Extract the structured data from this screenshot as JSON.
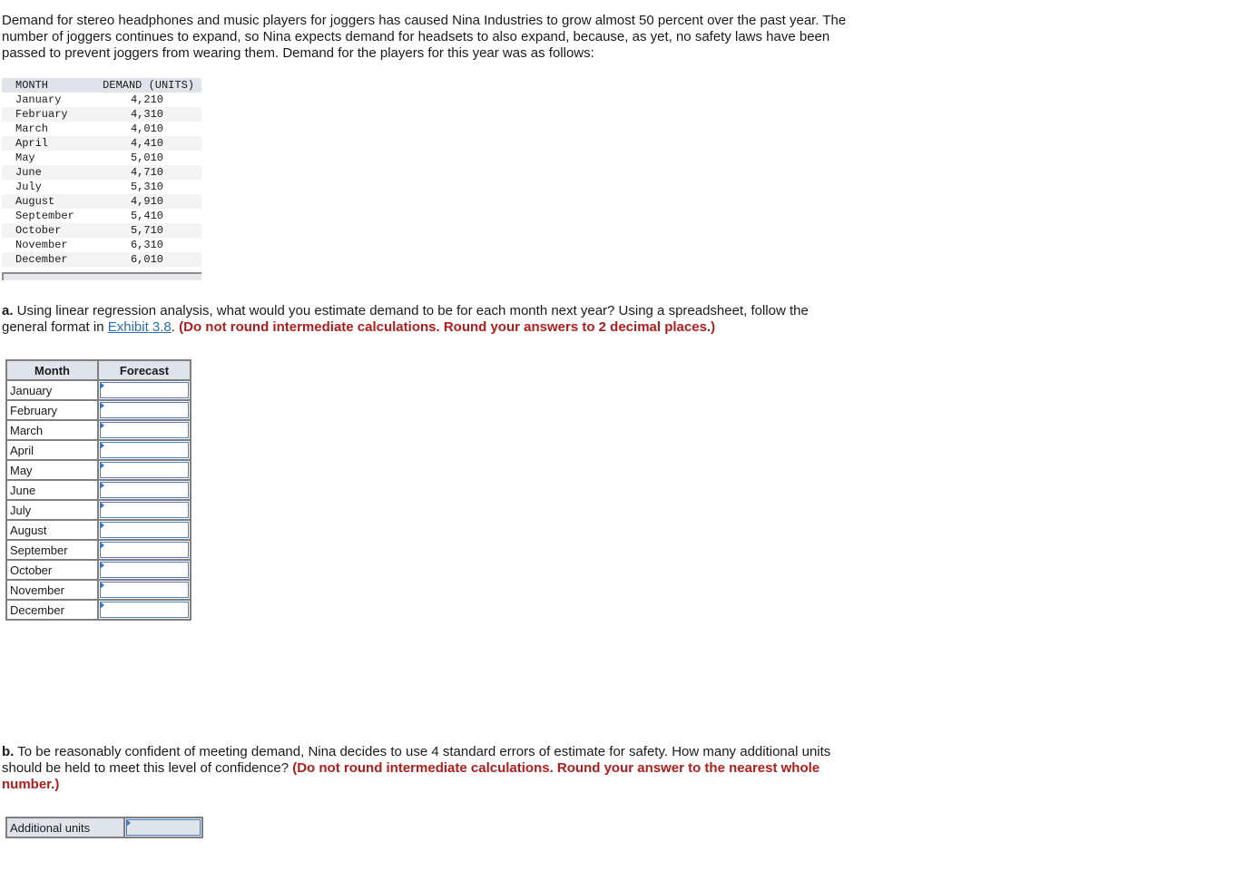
{
  "intro": "Demand for stereo headphones and music players for joggers has caused Nina Industries to grow almost 50 percent over the past year. The number of joggers continues to expand, so Nina expects demand for headsets to also expand, because, as yet, no safety laws have been passed to prevent joggers from wearing them. Demand for the players for this year was as follows:",
  "demand_table": {
    "headers": [
      "MONTH",
      "DEMAND (UNITS)"
    ],
    "rows": [
      [
        "January",
        "4,210"
      ],
      [
        "February",
        "4,310"
      ],
      [
        "March",
        "4,010"
      ],
      [
        "April",
        "4,410"
      ],
      [
        "May",
        "5,010"
      ],
      [
        "June",
        "4,710"
      ],
      [
        "July",
        "5,310"
      ],
      [
        "August",
        "4,910"
      ],
      [
        "September",
        "5,410"
      ],
      [
        "October",
        "5,710"
      ],
      [
        "November",
        "6,310"
      ],
      [
        "December",
        "6,010"
      ]
    ]
  },
  "part_a": {
    "label": "a.",
    "text1": " Using linear regression analysis, what would you estimate demand to be for each month next year? Using a spreadsheet, follow the general format in ",
    "link": "Exhibit 3.8",
    "text2": ". ",
    "instruction": "(Do not round intermediate calculations. Round your answers to 2 decimal places.)"
  },
  "forecast_table": {
    "headers": [
      "Month",
      "Forecast"
    ],
    "months": [
      "January",
      "February",
      "March",
      "April",
      "May",
      "June",
      "July",
      "August",
      "September",
      "October",
      "November",
      "December"
    ],
    "values": [
      "",
      "",
      "",
      "",
      "",
      "",
      "",
      "",
      "",
      "",
      "",
      ""
    ]
  },
  "part_b": {
    "label": "b.",
    "text": " To be reasonably confident of meeting demand, Nina decides to use 4 standard errors of estimate for safety. How many additional units should be held to meet this level of confidence? ",
    "instruction": "(Do not round intermediate calculations. Round your answer to the nearest whole number.)"
  },
  "additional_units": {
    "label": "Additional units",
    "value": ""
  }
}
